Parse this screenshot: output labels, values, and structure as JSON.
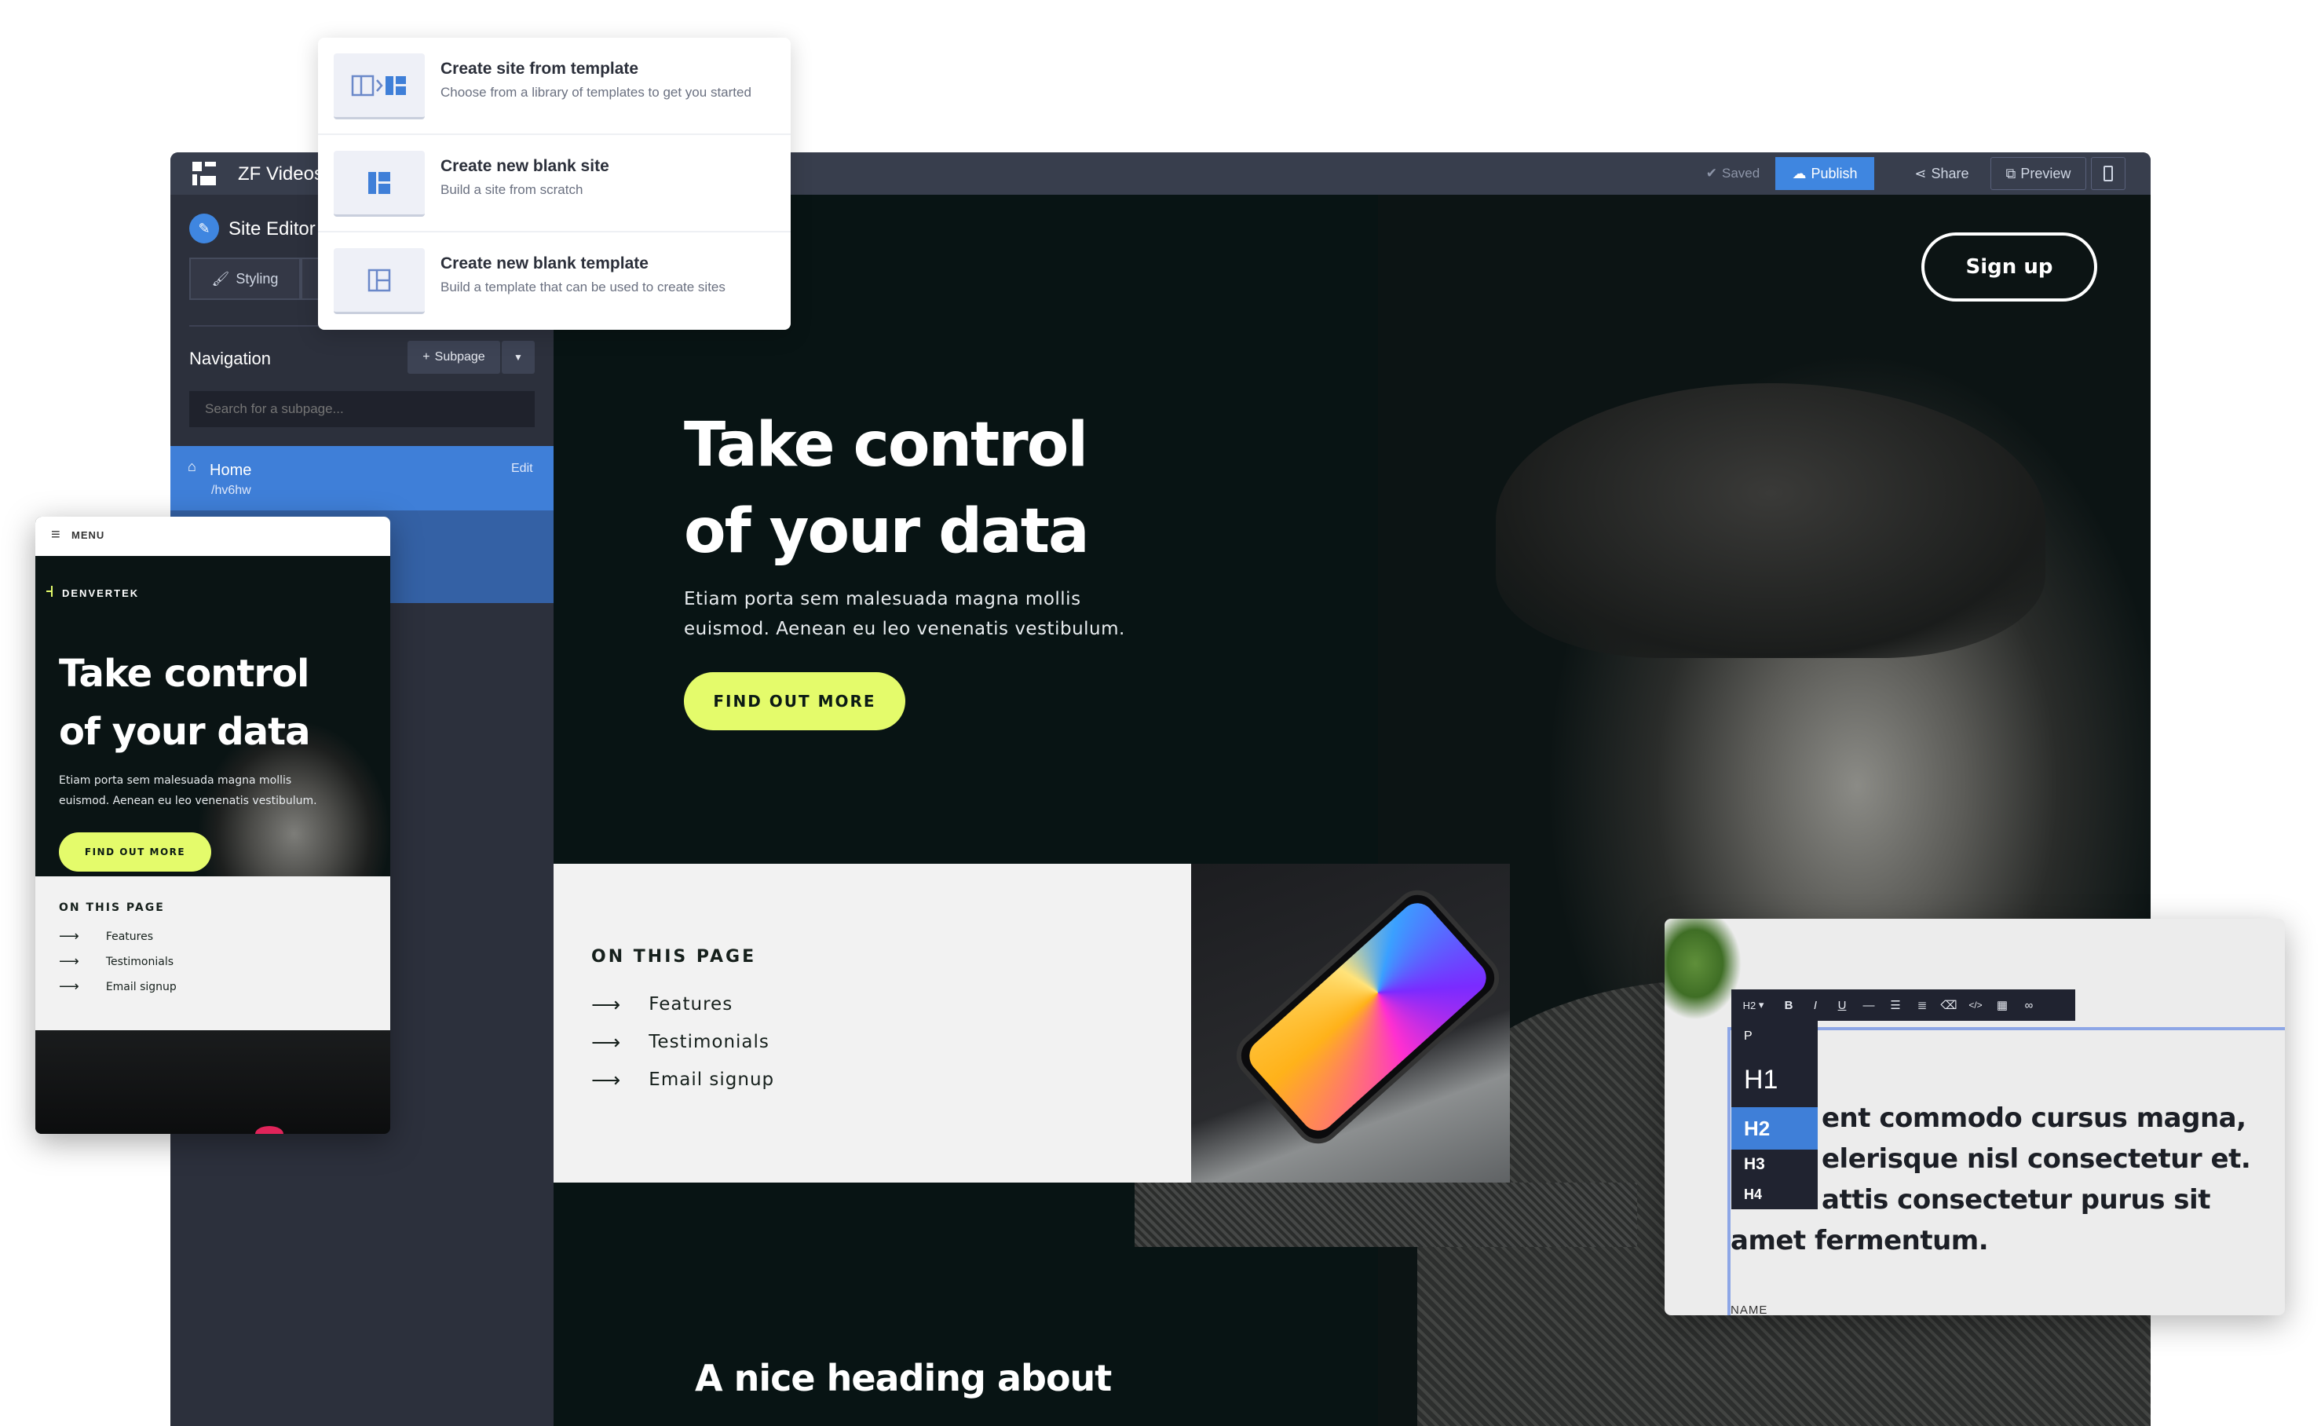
{
  "create_menu": {
    "items": [
      {
        "title": "Create site from template",
        "desc": "Choose from a library of templates to get you started",
        "icon": "template-icon"
      },
      {
        "title": "Create new blank site",
        "desc": "Build a site from scratch",
        "icon": "blank-site-icon"
      },
      {
        "title": "Create new blank template",
        "desc": "Build a template that can be used to create sites",
        "icon": "blank-template-icon"
      }
    ]
  },
  "topbar": {
    "app_name": "ZF Videos",
    "saved": "Saved",
    "publish": "Publish",
    "share": "Share",
    "preview": "Preview"
  },
  "sidebar": {
    "title": "Site Editor",
    "styling_tab": "Styling",
    "navigation_label": "Navigation",
    "subpage_button": "Subpage",
    "search_placeholder": "Search for a subpage...",
    "pages": [
      {
        "name": "Home",
        "path": "/hv6hw",
        "action": "Edit"
      }
    ]
  },
  "hero": {
    "signup": "Sign up",
    "heading_line1": "Take control",
    "heading_line2": "of your data",
    "subtext_line1": "Etiam porta sem malesuada magna mollis",
    "subtext_line2": "euismod. Aenean eu leo venenatis vestibulum.",
    "cta": "FIND OUT MORE"
  },
  "on_this_page": {
    "title": "ON THIS PAGE",
    "links": [
      "Features",
      "Testimonials",
      "Email signup"
    ]
  },
  "bottom_heading": "A nice heading about",
  "mobile": {
    "menu": "MENU",
    "brand": "DENVERTEK",
    "heading_line1": "Take control",
    "heading_line2": "of your data",
    "subtext_line1": "Etiam porta sem malesuada magna mollis",
    "subtext_line2": "euismod. Aenean eu leo venenatis vestibulum.",
    "cta": "FIND OUT MORE",
    "on_this_page": "ON THIS PAGE",
    "links": [
      "Features",
      "Testimonials",
      "Email signup"
    ]
  },
  "text_editor": {
    "format_select": "H2",
    "headings": [
      "P",
      "H1",
      "H2",
      "H3",
      "H4"
    ],
    "body_lines": [
      "ent commodo cursus magna,",
      "elerisque nisl consectetur et.",
      "attis consectetur purus sit",
      "amet fermentum."
    ],
    "name_label": "NAME"
  },
  "colors": {
    "accent_green": "#e4fb6b",
    "publish_blue": "#3f86e0",
    "nav_active": "#3f7fd8"
  }
}
